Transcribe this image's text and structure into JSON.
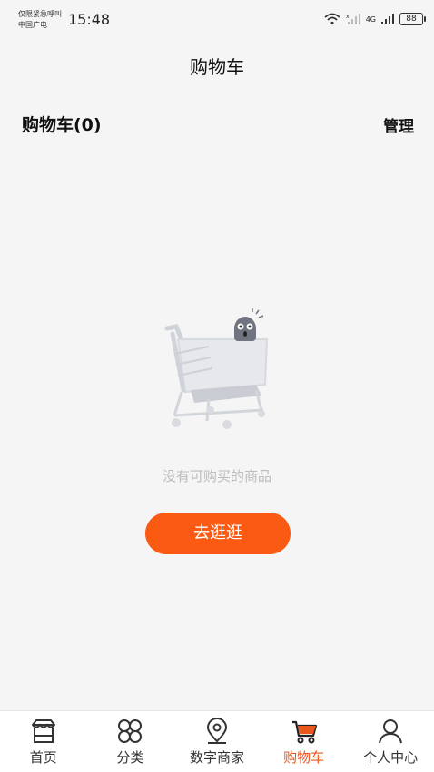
{
  "status_bar": {
    "carrier_line1": "仅限紧急呼叫",
    "carrier_line2": "中国广电",
    "time": "15:48",
    "battery": "88",
    "network": "4G"
  },
  "header": {
    "title": "购物车"
  },
  "cart": {
    "heading": "购物车(0)",
    "manage_label": "管理"
  },
  "empty_state": {
    "message": "没有可购买的商品",
    "button_label": "去逛逛",
    "illustration_icon": "empty-cart-icon"
  },
  "tabs": [
    {
      "label": "首页",
      "icon": "store-icon",
      "active": false
    },
    {
      "label": "分类",
      "icon": "category-icon",
      "active": false
    },
    {
      "label": "数字商家",
      "icon": "location-pin-icon",
      "active": false
    },
    {
      "label": "购物车",
      "icon": "cart-icon",
      "active": true
    },
    {
      "label": "个人中心",
      "icon": "person-icon",
      "active": false
    }
  ],
  "colors": {
    "accent": "#fb5a12",
    "active_tab": "#e8561c",
    "background": "#f5f5f5"
  }
}
